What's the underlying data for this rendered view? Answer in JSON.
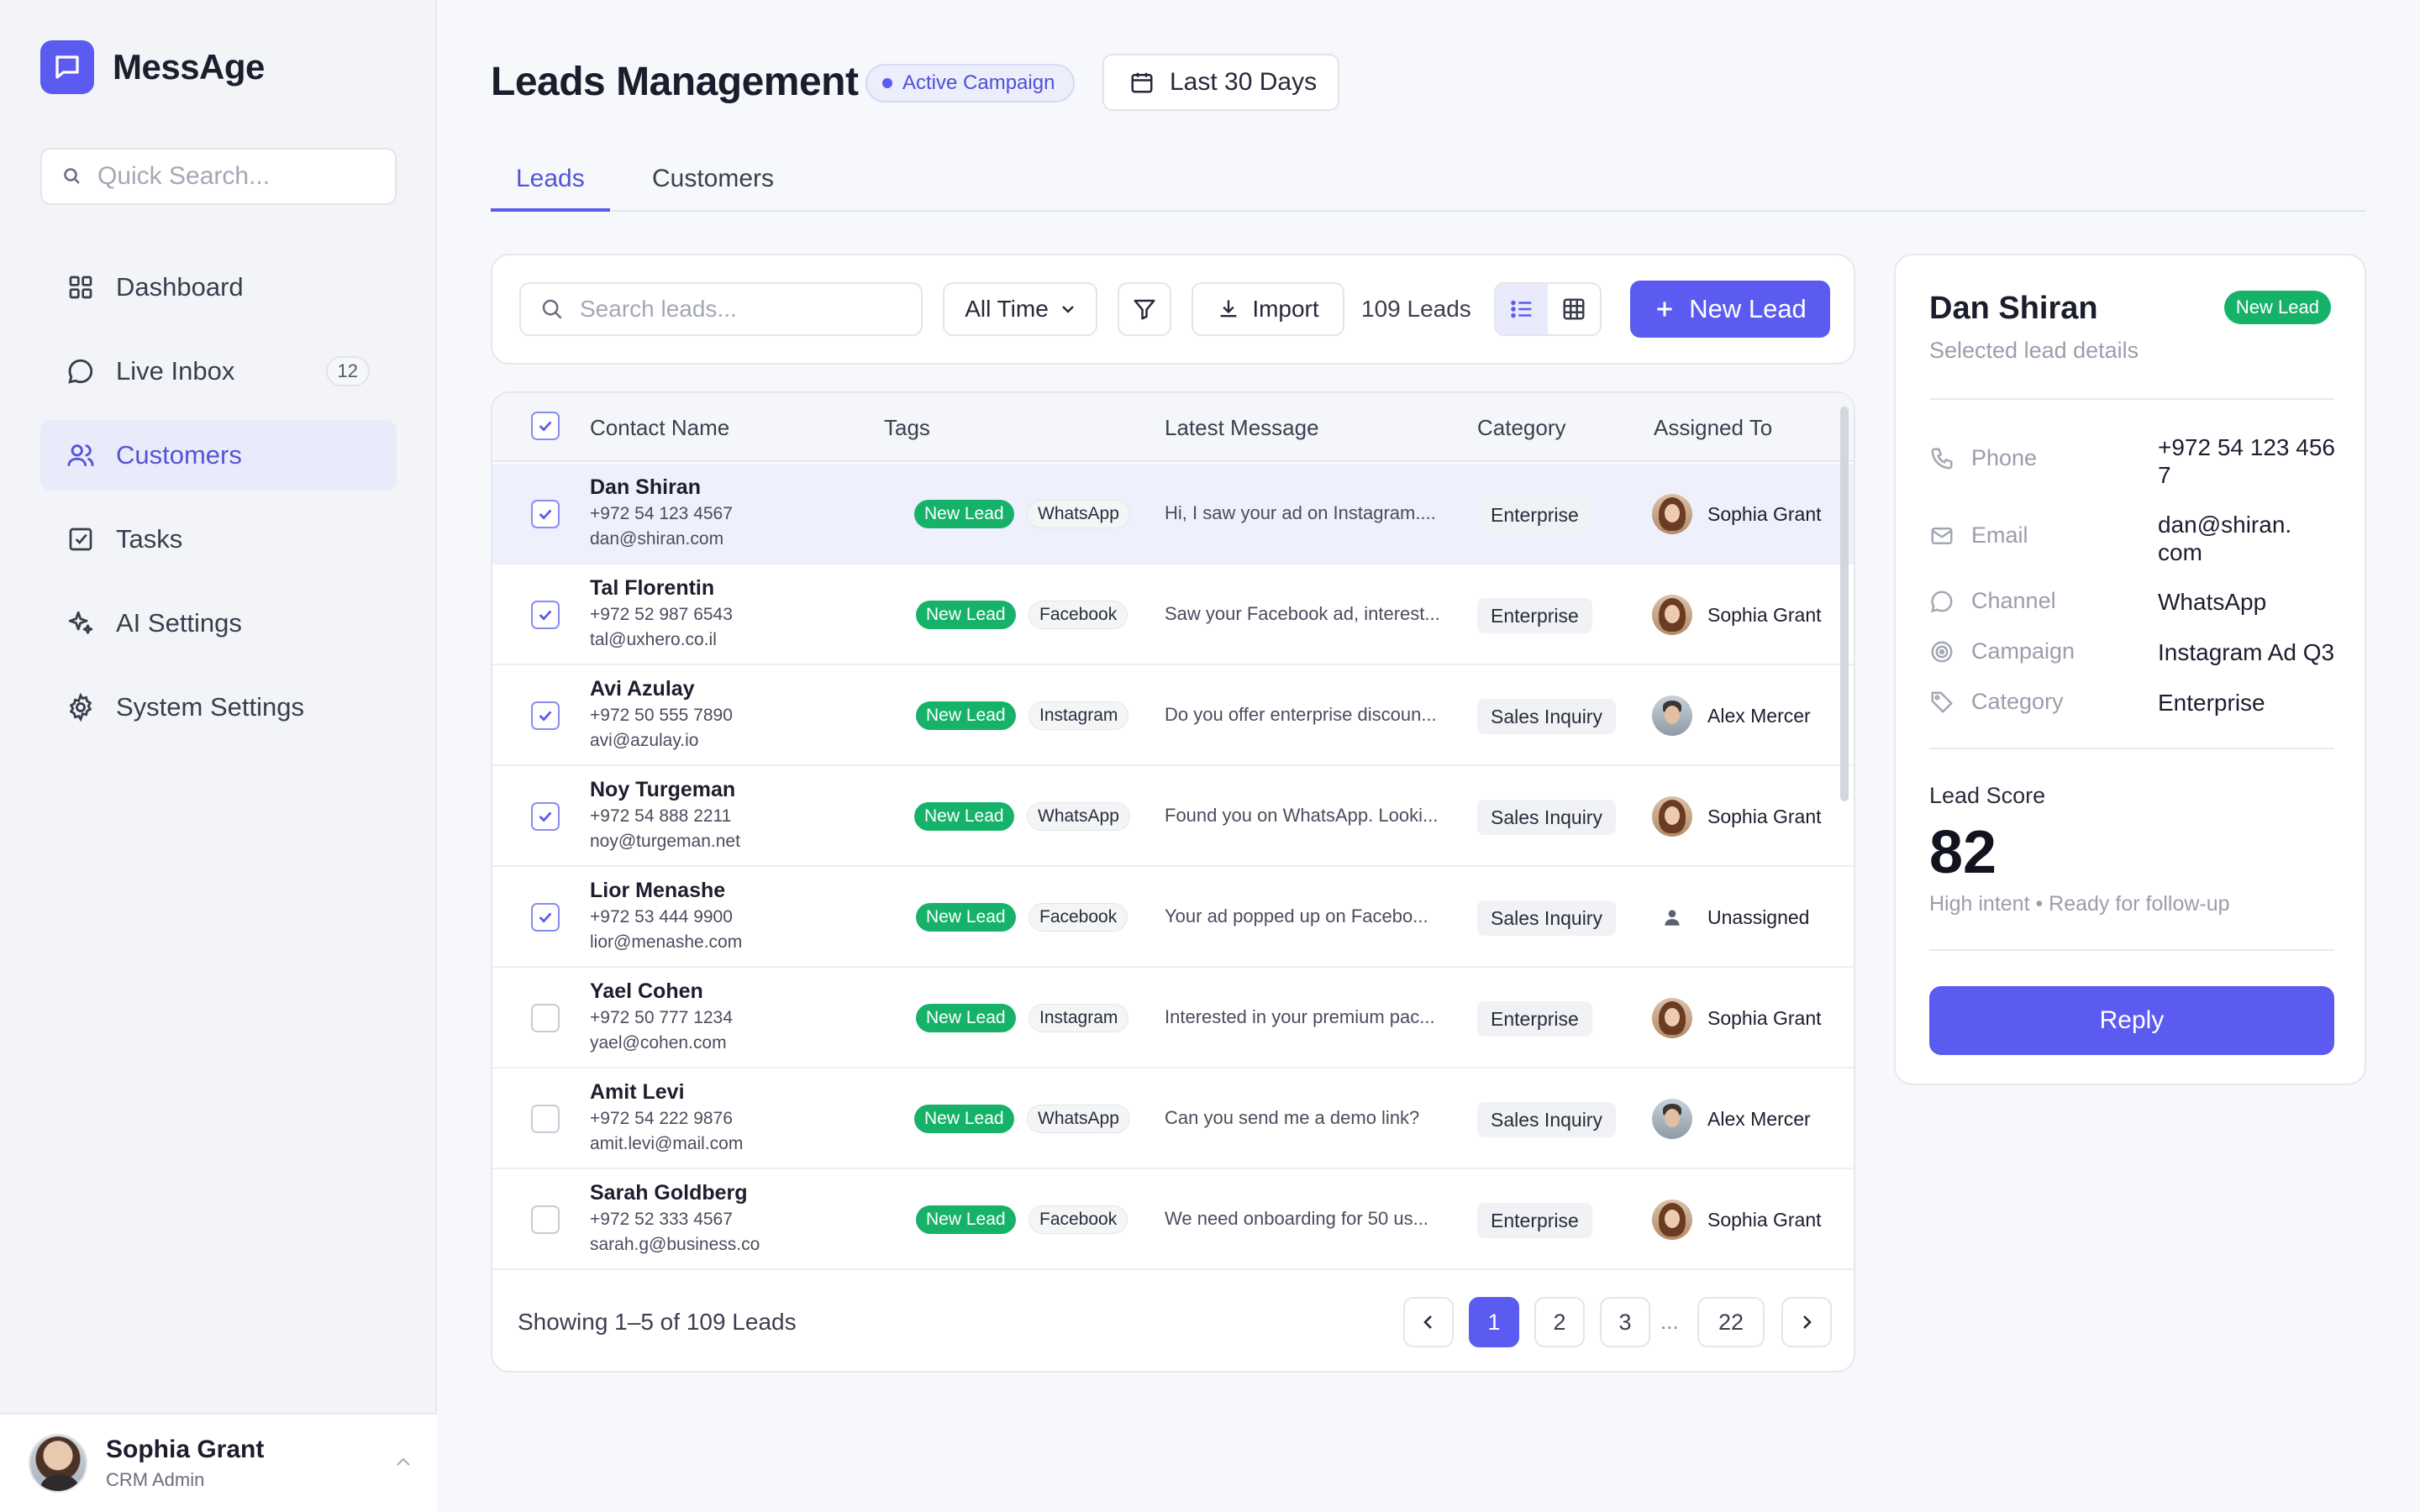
{
  "app": {
    "name": "MessAge"
  },
  "sidebar": {
    "search_placeholder": "Quick Search...",
    "items": [
      {
        "label": "Dashboard",
        "icon": "grid-icon"
      },
      {
        "label": "Live Inbox",
        "icon": "chat-bubble-icon",
        "badge": "12"
      },
      {
        "label": "Customers",
        "icon": "users-icon",
        "active": true
      },
      {
        "label": "Tasks",
        "icon": "checkbox-icon"
      },
      {
        "label": "AI Settings",
        "icon": "sparkle-icon"
      },
      {
        "label": "System Settings",
        "icon": "gear-icon"
      }
    ],
    "user": {
      "name": "Sophia Grant",
      "role": "CRM Admin"
    }
  },
  "header": {
    "title": "Leads Management",
    "campaign_badge": "Active Campaign",
    "date_range": "Last 30 Days"
  },
  "tabs": [
    {
      "label": "Leads",
      "active": true
    },
    {
      "label": "Customers",
      "active": false
    }
  ],
  "toolbar": {
    "search_placeholder": "Search leads...",
    "time_filter": "All Time",
    "import_label": "Import",
    "leads_count": "109 Leads",
    "new_lead_label": "New Lead"
  },
  "table": {
    "columns": [
      "Contact Name",
      "Tags",
      "Latest Message",
      "Category",
      "Assigned To"
    ],
    "rows": [
      {
        "name": "Dan Shiran",
        "phone": "+972 54 123 4567",
        "email": "dan@shiran.com",
        "tag": "New Lead",
        "channel": "WhatsApp",
        "message": "Hi, I saw your ad on Instagram....",
        "category": "Enterprise",
        "assignee": "Sophia Grant",
        "checked": true
      },
      {
        "name": "Tal Florentin",
        "phone": "+972 52 987 6543",
        "email": "tal@uxhero.co.il",
        "tag": "New Lead",
        "channel": "Facebook",
        "message": "Saw your Facebook ad, interest...",
        "category": "Enterprise",
        "assignee": "Sophia Grant",
        "checked": true
      },
      {
        "name": "Avi Azulay",
        "phone": "+972 50 555 7890",
        "email": "avi@azulay.io",
        "tag": "New Lead",
        "channel": "Instagram",
        "message": "Do you offer enterprise discoun...",
        "category": "Sales Inquiry",
        "assignee": "Alex Mercer",
        "checked": true
      },
      {
        "name": "Noy Turgeman",
        "phone": "+972 54 888 2211",
        "email": "noy@turgeman.net",
        "tag": "New Lead",
        "channel": "WhatsApp",
        "message": "Found you on WhatsApp. Looki...",
        "category": "Sales Inquiry",
        "assignee": "Sophia Grant",
        "checked": true
      },
      {
        "name": "Lior Menashe",
        "phone": "+972 53 444 9900",
        "email": "lior@menashe.com",
        "tag": "New Lead",
        "channel": "Facebook",
        "message": "Your ad popped up on Facebo...",
        "category": "Sales Inquiry",
        "assignee": "Unassigned",
        "checked": true
      },
      {
        "name": "Yael Cohen",
        "phone": "+972 50 777 1234",
        "email": "yael@cohen.com",
        "tag": "New Lead",
        "channel": "Instagram",
        "message": "Interested in your premium pac...",
        "category": "Enterprise",
        "assignee": "Sophia Grant",
        "checked": false
      },
      {
        "name": "Amit Levi",
        "phone": "+972 54 222 9876",
        "email": "amit.levi@mail.com",
        "tag": "New Lead",
        "channel": "WhatsApp",
        "message": "Can you send me a demo link?",
        "category": "Sales Inquiry",
        "assignee": "Alex Mercer",
        "checked": false
      },
      {
        "name": "Sarah Goldberg",
        "phone": "+972 52 333 4567",
        "email": "sarah.g@business.co",
        "tag": "New Lead",
        "channel": "Facebook",
        "message": "We need onboarding for 50 us...",
        "category": "Enterprise",
        "assignee": "Sophia Grant",
        "checked": false
      }
    ],
    "footer": "Showing 1–5 of 109 Leads",
    "pages": [
      "1",
      "2",
      "3",
      "22"
    ],
    "ellipsis": "...",
    "current_page": "1"
  },
  "detail": {
    "name": "Dan Shiran",
    "badge": "New Lead",
    "subtitle": "Selected lead details",
    "fields": [
      {
        "label": "Phone",
        "value": "+972 54 123 4567",
        "icon": "phone-icon"
      },
      {
        "label": "Email",
        "value": "dan@shiran.com",
        "icon": "mail-icon"
      },
      {
        "label": "Channel",
        "value": "WhatsApp",
        "icon": "chat-bubble-icon"
      },
      {
        "label": "Campaign",
        "value": "Instagram Ad Q3",
        "icon": "target-icon"
      },
      {
        "label": "Category",
        "value": "Enterprise",
        "icon": "tag-icon"
      }
    ],
    "score_label": "Lead Score",
    "score": "82",
    "score_note": "High intent • Ready for follow-up",
    "reply_label": "Reply"
  },
  "colors": {
    "accent": "#5b5bf1",
    "success": "#17b26a"
  }
}
